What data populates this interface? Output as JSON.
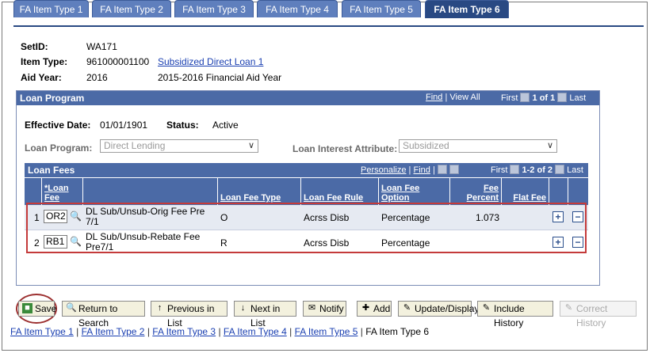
{
  "tabs": [
    "FA Item Type 1",
    "FA Item Type 2",
    "FA Item Type 3",
    "FA Item Type 4",
    "FA Item Type 5",
    "FA Item Type 6"
  ],
  "header": {
    "setid_label": "SetID:",
    "setid_value": "WA171",
    "itemtype_label": "Item Type:",
    "itemtype_value": "961000001100",
    "itemtype_link": "Subsidized Direct Loan 1",
    "aidyear_label": "Aid Year:",
    "aidyear_value": "2016",
    "aidyear_desc": "2015-2016 Financial Aid Year"
  },
  "loan_program": {
    "title": "Loan Program",
    "find": "Find",
    "sep": "|",
    "view_all": "View All",
    "first": "First",
    "pager": "1 of 1",
    "last": "Last",
    "eff_date_label": "Effective Date:",
    "eff_date_value": "01/01/1901",
    "status_label": "Status:",
    "status_value": "Active",
    "program_label": "Loan Program:",
    "program_value": "Direct Lending",
    "interest_label": "Loan Interest Attribute:",
    "interest_value": "Subsidized"
  },
  "loan_fees": {
    "title": "Loan Fees",
    "personalize": "Personalize",
    "sep": "|",
    "find": "Find",
    "first": "First",
    "pager": "1-2 of 2",
    "last": "Last",
    "columns": {
      "loan_fee": "*Loan Fee",
      "loan_fee_type": "Loan Fee Type",
      "loan_fee_rule": "Loan Fee Rule",
      "loan_fee_option": "Loan Fee Option",
      "fee_percent": "Fee Percent",
      "flat_fee": "Flat Fee"
    },
    "rows": [
      {
        "num": "1",
        "code": "OR2",
        "desc": "DL Sub/Unsub-Orig Fee Pre 7/1",
        "type": "O",
        "rule": "Acrss Disb",
        "option": "Percentage",
        "percent": "1.073",
        "flat": ""
      },
      {
        "num": "2",
        "code": "RB1",
        "desc": "DL Sub/Unsub-Rebate Fee Pre7/1",
        "type": "R",
        "rule": "Acrss Disb",
        "option": "Percentage",
        "percent": "",
        "flat": ""
      }
    ]
  },
  "toolbar": {
    "save": "Save",
    "return_to_search": "Return to Search",
    "previous_in_list": "Previous in List",
    "next_in_list": "Next in List",
    "notify": "Notify",
    "add": "Add",
    "update_display": "Update/Display",
    "include_history": "Include History",
    "correct_history": "Correct History"
  },
  "bottom_links": [
    "FA Item Type 1",
    "FA Item Type 2",
    "FA Item Type 3",
    "FA Item Type 4",
    "FA Item Type 5",
    "FA Item Type 6"
  ]
}
